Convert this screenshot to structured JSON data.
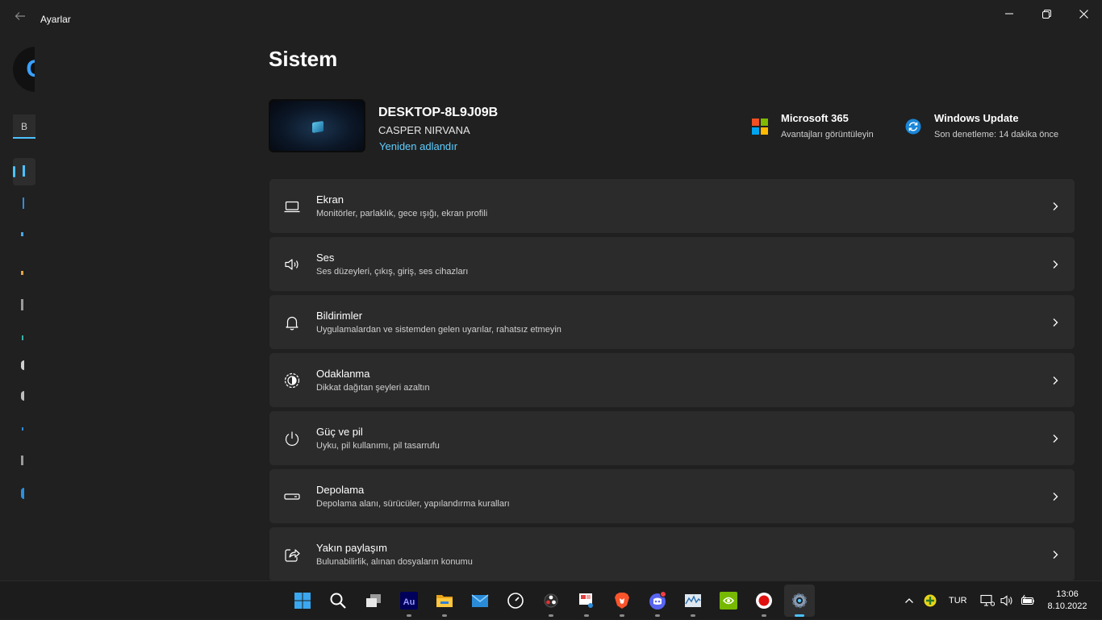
{
  "window": {
    "title": "Ayarlar"
  },
  "nav": {
    "search_value": "B"
  },
  "main": {
    "page_title": "Sistem",
    "device": {
      "name": "DESKTOP-8L9J09B",
      "model": "CASPER NIRVANA",
      "rename_label": "Yeniden adlandır"
    },
    "promos": [
      {
        "title": "Microsoft 365",
        "subtitle": "Avantajları görüntüleyin",
        "icon": "microsoft-logo-icon"
      },
      {
        "title": "Windows Update",
        "subtitle": "Son denetleme: 14 dakika önce",
        "icon": "windows-update-icon"
      }
    ],
    "settings": [
      {
        "title": "Ekran",
        "subtitle": "Monitörler, parlaklık, gece ışığı, ekran profili",
        "icon": "laptop-icon"
      },
      {
        "title": "Ses",
        "subtitle": "Ses düzeyleri, çıkış, giriş, ses cihazları",
        "icon": "speaker-icon"
      },
      {
        "title": "Bildirimler",
        "subtitle": "Uygulamalardan ve sistemden gelen uyarılar, rahatsız etmeyin",
        "icon": "bell-icon"
      },
      {
        "title": "Odaklanma",
        "subtitle": "Dikkat dağıtan şeyleri azaltın",
        "icon": "focus-icon"
      },
      {
        "title": "Güç ve pil",
        "subtitle": "Uyku, pil kullanımı, pil tasarrufu",
        "icon": "power-icon"
      },
      {
        "title": "Depolama",
        "subtitle": "Depolama alanı, sürücüler, yapılandırma kuralları",
        "icon": "storage-icon"
      },
      {
        "title": "Yakın paylaşım",
        "subtitle": "Bulunabilirlik, alınan dosyaların konumu",
        "icon": "share-icon"
      }
    ]
  },
  "taskbar": {
    "apps": [
      "start-icon",
      "search-icon",
      "task-view-icon",
      "audition-icon",
      "file-explorer-icon",
      "mail-icon",
      "speedometer-icon",
      "obs-icon",
      "snipping-tool-icon",
      "brave-icon",
      "discord-icon",
      "resource-monitor-icon",
      "nvidia-icon",
      "record-icon",
      "settings-gear-icon"
    ],
    "language": "TUR",
    "time": "13:06",
    "date": "8.10.2022"
  },
  "colors": {
    "background": "#202020",
    "card": "#2b2b2b",
    "accent": "#4cc2ff",
    "link": "#60cdff",
    "taskbar": "#1c1c1c"
  }
}
